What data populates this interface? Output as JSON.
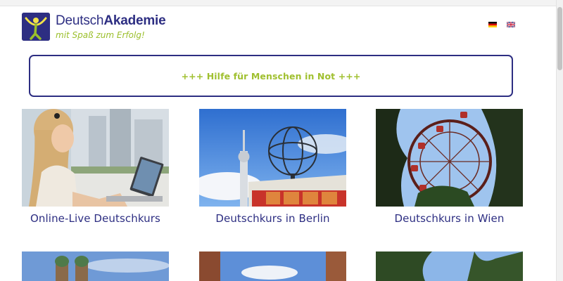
{
  "logo": {
    "name_regular": "Deutsch",
    "name_bold": "Akademie",
    "slogan": "mit Spaß zum Erfolg!"
  },
  "languages": [
    {
      "code": "de",
      "icon": "german-flag-icon"
    },
    {
      "code": "en",
      "icon": "uk-flag-icon"
    }
  ],
  "notice": {
    "text": "+++ Hilfe für Menschen in Not +++"
  },
  "courses": [
    {
      "title": "Online-Live Deutschkurs"
    },
    {
      "title": "Deutschkurs in Berlin"
    },
    {
      "title": "Deutschkurs in Wien"
    }
  ],
  "colors": {
    "brand_blue": "#2d2e82",
    "brand_green": "#9bbf2b"
  }
}
